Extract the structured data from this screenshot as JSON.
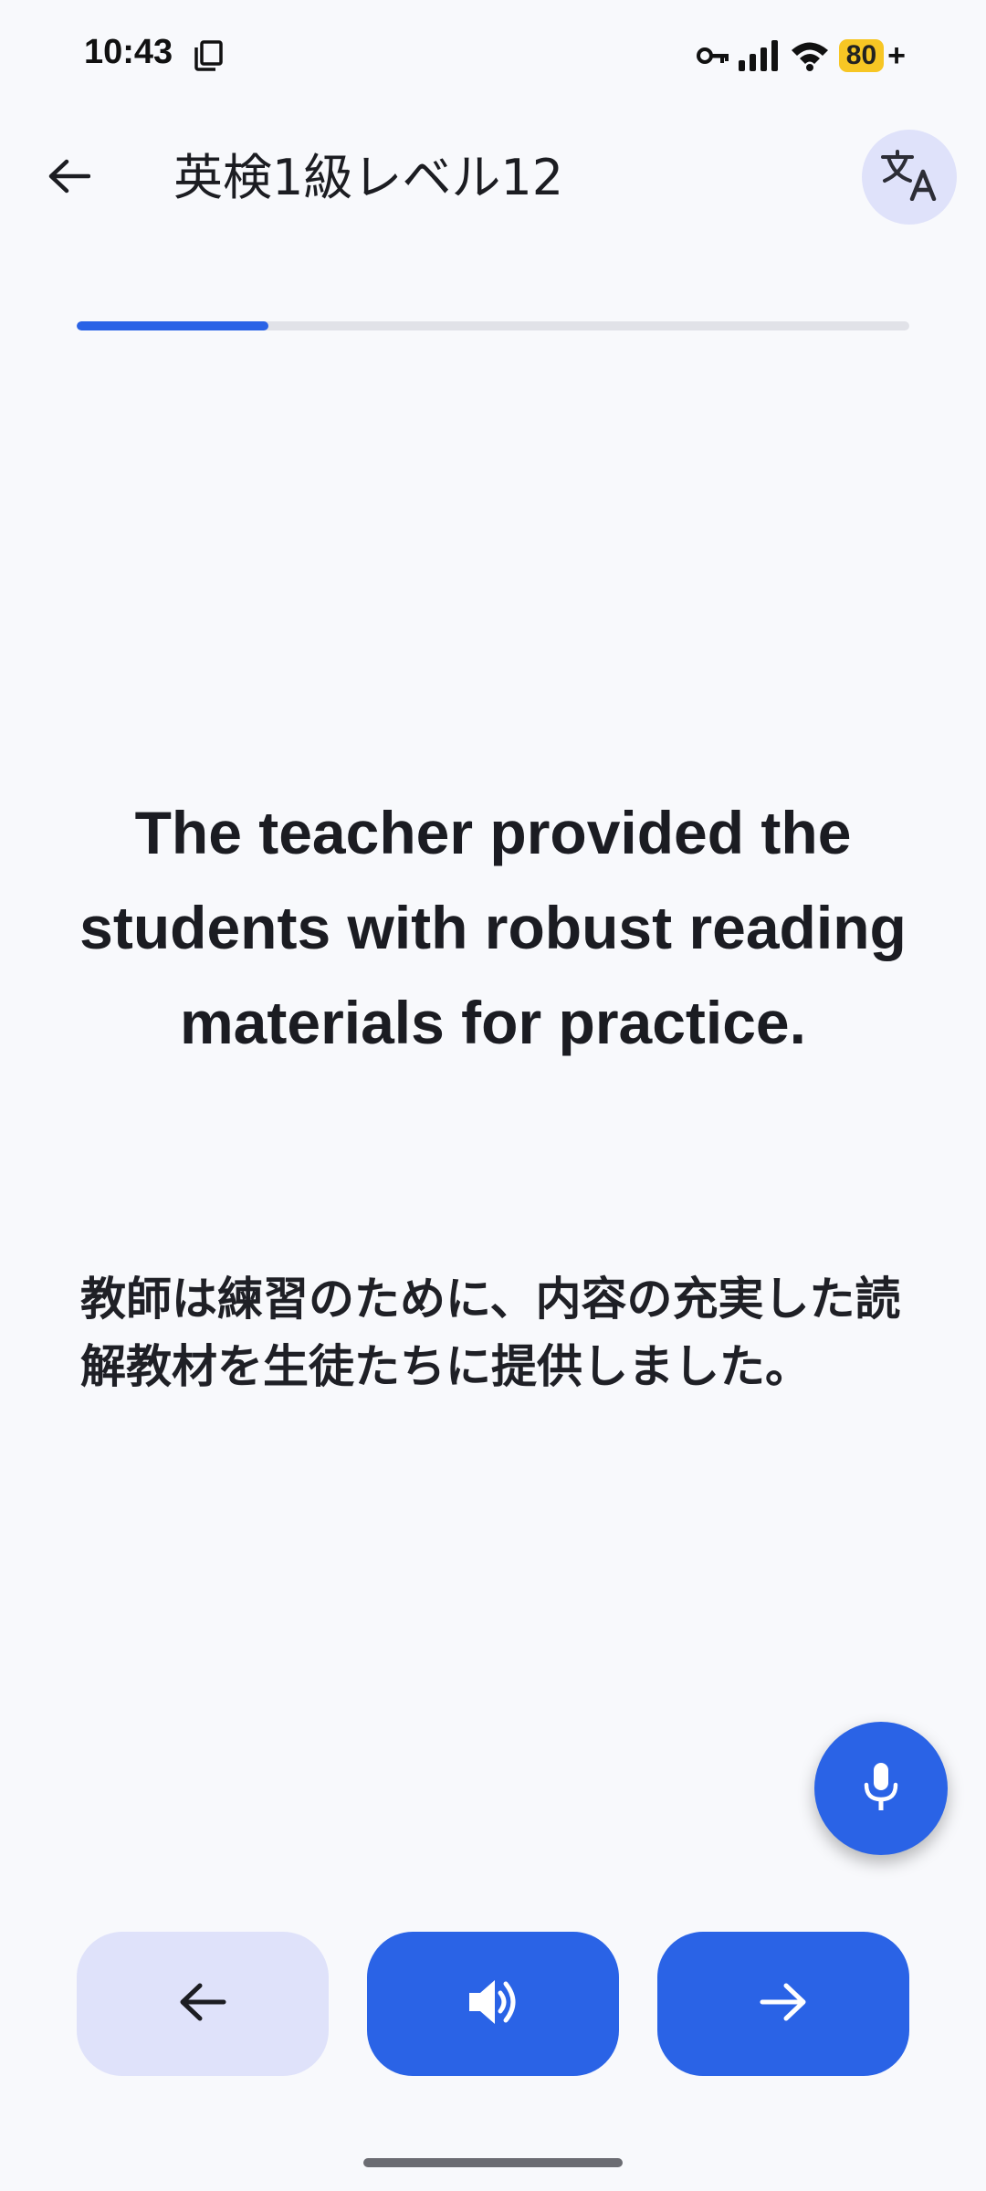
{
  "status_bar": {
    "time": "10:43",
    "battery_level": "80",
    "battery_suffix": "+",
    "icons": [
      "copy-icon",
      "key-icon",
      "signal-icon",
      "wifi-icon",
      "battery-icon"
    ]
  },
  "app_bar": {
    "title": "英検1級レベル12",
    "back_icon": "arrow-left-icon",
    "translate_icon": "translate-icon"
  },
  "progress": {
    "fraction": 0.23
  },
  "content": {
    "sentence_en": "The teacher provided the students with robust reading materials for practice.",
    "sentence_ja": "教師は練習のために、内容の充実した読解教材を生徒たちに提供しました。"
  },
  "fab": {
    "icon": "microphone-icon"
  },
  "navigation": {
    "prev_icon": "arrow-left-icon",
    "audio_icon": "speaker-icon",
    "next_icon": "arrow-right-icon"
  },
  "colors": {
    "accent": "#2a63e6",
    "accent_light": "#dfe2fa",
    "background": "#f8f9fc",
    "battery": "#f7c624"
  }
}
